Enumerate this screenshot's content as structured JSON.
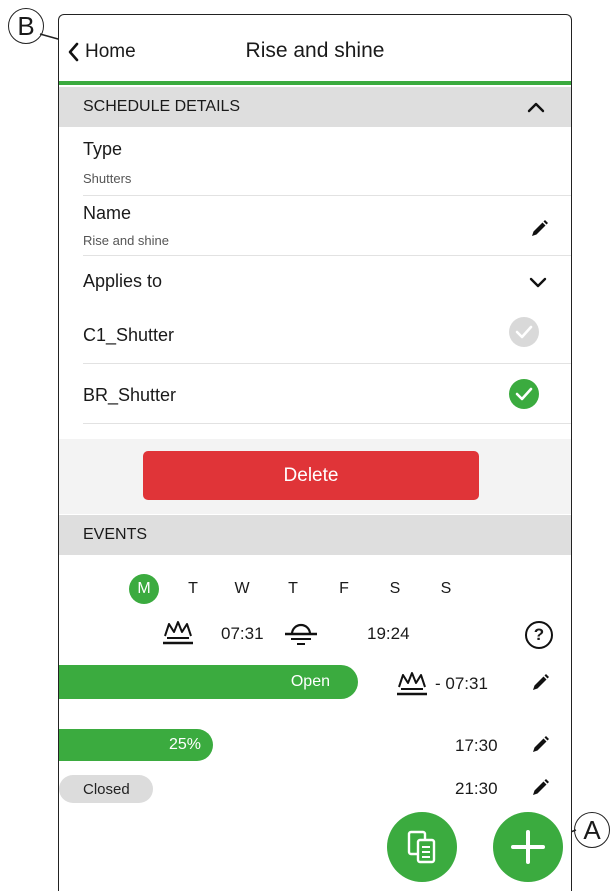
{
  "callouts": {
    "b": "B",
    "a": "A"
  },
  "header": {
    "back_label": "Home",
    "title": "Rise and shine"
  },
  "schedule": {
    "section_label": "SCHEDULE DETAILS",
    "type_label": "Type",
    "type_value": "Shutters",
    "name_label": "Name",
    "name_value": "Rise and shine",
    "applies_label": "Applies to",
    "devices": [
      {
        "name": "C1_Shutter",
        "selected": false
      },
      {
        "name": "BR_Shutter",
        "selected": true
      }
    ],
    "delete_label": "Delete"
  },
  "events": {
    "section_label": "EVENTS",
    "days": [
      "M",
      "T",
      "W",
      "T",
      "F",
      "S",
      "S"
    ],
    "active_day": "M",
    "sunrise_time": "07:31",
    "sunset_time": "19:24",
    "help_label": "?",
    "items": [
      {
        "label": "Open",
        "level_percent": 100,
        "time": "- 07:31",
        "icon": "sunrise-icon"
      },
      {
        "label": "25%",
        "level_percent": 25,
        "time": "17:30"
      },
      {
        "label": "Closed",
        "level_percent": 0,
        "time": "21:30"
      }
    ]
  },
  "colors": {
    "accent": "#3bab3f",
    "danger": "#e03438",
    "section_bg": "#dedede",
    "inactive_check": "#d9d9d9"
  }
}
